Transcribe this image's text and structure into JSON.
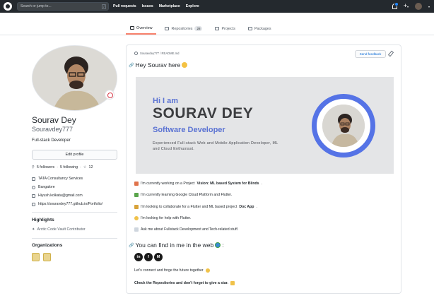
{
  "header": {
    "search_placeholder": "Search or jump to...",
    "search_shortcut": "/",
    "nav": [
      "Pull requests",
      "Issues",
      "Marketplace",
      "Explore"
    ]
  },
  "tabs": [
    {
      "label": "Overview",
      "active": true
    },
    {
      "label": "Repositories",
      "count": "28"
    },
    {
      "label": "Projects"
    },
    {
      "label": "Packages"
    }
  ],
  "profile": {
    "name": "Sourav Dey",
    "login": "Souravdey777",
    "bio": "Full-stack Developer",
    "edit_label": "Edit profile",
    "followers": "5 followers",
    "following": "5 following",
    "stars": "12",
    "company": "TATA Consultancy Services",
    "location": "Bangalore",
    "email": "Hiyush.kolkata@gmail.com",
    "website": "https://souravdey777.github.io/Portfolio/",
    "highlights_title": "Highlights",
    "highlight_item": "Arctic Code Vault Contributor",
    "organizations_title": "Organizations"
  },
  "readme": {
    "path": "Souravdey777 / README.md",
    "feedback_label": "Send feedback",
    "greeting": "Hey Sourav here",
    "banner": {
      "hi": "Hi I am",
      "name": "SOURAV DEY",
      "role": "Software Developer",
      "desc": "Experienced Full-stack Web and Mobile Application Developer, ML and Cloud Enthusiast."
    },
    "lines": [
      {
        "pre": "I'm currently working on a Project ",
        "bold": "Vision: ML based System for Blinds",
        "post": "."
      },
      {
        "pre": "I'm currently learning Google Cloud Platform and Flutter.",
        "bold": "",
        "post": ""
      },
      {
        "pre": "I'm looking to collaborate for a Flutter and ML based project ",
        "bold": "Doc App",
        "post": "."
      },
      {
        "pre": "I'm looking for help with Flutter.",
        "bold": "",
        "post": ""
      },
      {
        "pre": "Ask me about Fullstack Development and Tech-related stuff.",
        "bold": "",
        "post": ""
      }
    ],
    "find_me": "You can find in me in the web",
    "connect": "Let's connect and forge the future together",
    "closing": "Check the Repositories and don't forget to give a star."
  }
}
